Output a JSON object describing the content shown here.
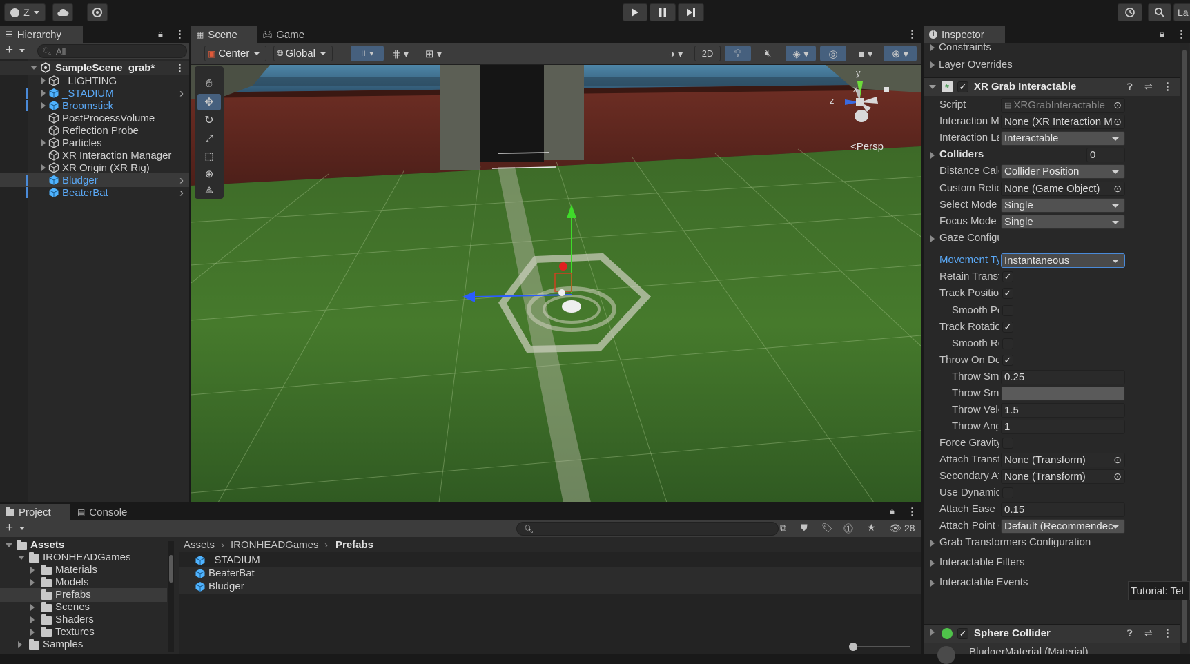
{
  "topbar": {
    "account_label": "Z",
    "play_icon": "play-icon",
    "pause_icon": "pause-icon",
    "step_icon": "step-icon",
    "layout_label": "La"
  },
  "hierarchy": {
    "tab": "Hierarchy",
    "search_placeholder": "All",
    "scene": "SampleScene_grab*",
    "items": [
      {
        "label": "_LIGHTING",
        "blue": false
      },
      {
        "label": "_STADIUM",
        "blue": true
      },
      {
        "label": "Broomstick",
        "blue": true
      },
      {
        "label": "PostProcessVolume",
        "blue": false
      },
      {
        "label": "Reflection Probe",
        "blue": false
      },
      {
        "label": "Particles",
        "blue": false
      },
      {
        "label": "XR Interaction Manager",
        "blue": false
      },
      {
        "label": "XR Origin (XR Rig)",
        "blue": false
      },
      {
        "label": "Bludger",
        "blue": true
      },
      {
        "label": "BeaterBat",
        "blue": true
      }
    ]
  },
  "scene": {
    "tab_scene": "Scene",
    "tab_game": "Game",
    "pivot": "Center",
    "space": "Global",
    "mode_2d": "2D",
    "persp": "<Persp",
    "gizmo_y": "y",
    "gizmo_z": "z",
    "gizmo_x": "x"
  },
  "project": {
    "tab_project": "Project",
    "tab_console": "Console",
    "hidden_count": "28",
    "tree": [
      {
        "label": "Assets",
        "bold": true
      },
      {
        "label": "IRONHEADGames",
        "bold": false
      },
      {
        "label": "Materials",
        "bold": false
      },
      {
        "label": "Models",
        "bold": false
      },
      {
        "label": "Prefabs",
        "bold": false
      },
      {
        "label": "Scenes",
        "bold": false
      },
      {
        "label": "Shaders",
        "bold": false
      },
      {
        "label": "Textures",
        "bold": false
      },
      {
        "label": "Samples",
        "bold": false
      }
    ],
    "breadcrumb": [
      "Assets",
      "IRONHEADGames",
      "Prefabs"
    ],
    "files": [
      "_STADIUM",
      "BeaterBat",
      "Bludger"
    ]
  },
  "inspector": {
    "tab": "Inspector",
    "constraints": "Constraints",
    "layer_overrides": "Layer Overrides",
    "component": "XR Grab Interactable",
    "rows": {
      "script_label": "Script",
      "script_value": "XRGrabInteractable",
      "manager_label": "Interaction Manager",
      "manager_value": "None (XR Interaction M",
      "layer_label": "Interaction Layer Ma",
      "layer_value": "Interactable",
      "colliders_label": "Colliders",
      "colliders_value": "0",
      "distance_label": "Distance Calculation",
      "distance_value": "Collider Position",
      "reticle_label": "Custom Reticle",
      "reticle_value": "None (Game Object)",
      "select_label": "Select Mode",
      "select_value": "Single",
      "focus_label": "Focus Mode",
      "focus_value": "Single",
      "gaze_label": "Gaze Configuration",
      "movement_label": "Movement Type",
      "movement_value": "Instantaneous",
      "retain_label": "Retain Transform Pa",
      "trackpos_label": "Track Position",
      "smoothpos_label": "Smooth Position",
      "trackrot_label": "Track Rotation",
      "smoothrot_label": "Smooth Rotation",
      "throw_label": "Throw On Detach",
      "throwsmooth1_label": "Throw Smoothing",
      "throwsmooth1_value": "0.25",
      "throwsmooth2_label": "Throw Smoothing",
      "throwvel_label": "Throw Velocity Sc",
      "throwvel_value": "1.5",
      "throwang_label": "Throw Angular Ve",
      "throwang_value": "1",
      "gravity_label": "Force Gravity On Det",
      "attach_label": "Attach Transform",
      "attach_value": "None (Transform)",
      "secattach_label": "Secondary Attach Tr",
      "secattach_value": "None (Transform)",
      "dynattach_label": "Use Dynamic Attach",
      "ease_label": "Attach Ease In Time",
      "ease_value": "0.15",
      "compat_label": "Attach Point Compat",
      "compat_value": "Default (Recommendec",
      "grabtrans_label": "Grab Transformers Configuration",
      "filters_label": "Interactable Filters",
      "events_label": "Interactable Events"
    },
    "sphere": "Sphere Collider",
    "material": "BludgerMaterial (Material)",
    "tooltip": "Tutorial: Tel"
  }
}
